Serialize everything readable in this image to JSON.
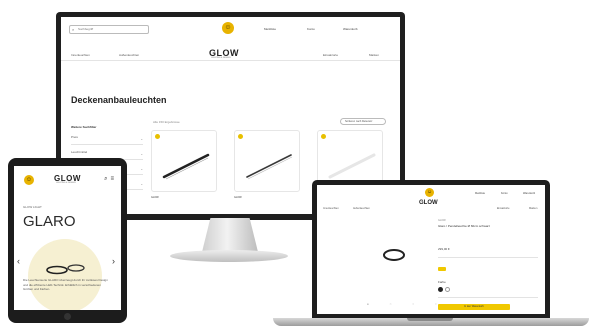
{
  "brand": {
    "name": "GLOW",
    "tagline": "LIGHTING & DESIGN",
    "logo_symbol": "☺",
    "accent_color": "#e8b300"
  },
  "monitor": {
    "search_placeholder": "Suchbegriff",
    "utility": {
      "wishlist": "Merkliste",
      "account": "Konto",
      "cart": "Warenkorb"
    },
    "nav_left": [
      "Innenleuchten",
      "Außenleuchten"
    ],
    "nav_right": [
      "Einsatzorte",
      "Marken"
    ],
    "page_title": "Deckenanbauleuchten",
    "filter_title": "Weitere Suchfilter",
    "filters": [
      "Preis",
      "Leuchtmittel",
      "Lichtfarbe",
      "Farbe"
    ],
    "result_count": "Alle 150 Ergebnisse",
    "sort_label": "Sortieren nach Relevanz",
    "products": [
      {
        "brand": "GLOW",
        "name": "Pendelleuchte"
      },
      {
        "brand": "GLOW",
        "name": "Deckenleuchte"
      },
      {
        "brand": "GLOW",
        "name": "Anbauleuchte"
      }
    ]
  },
  "tablet": {
    "breadcrumb": "GLOW LIGHT",
    "title": "GLARO",
    "description": "Die Leuchtenserie GLARO überzeugt durch ihr zeitloses Design und die effiziente LED-Technik. Erhältlich in verschiedenen Größen und Farben."
  },
  "laptop": {
    "utility": {
      "wishlist": "Merkliste",
      "account": "Konto",
      "cart": "Warenkorb"
    },
    "nav_left": [
      "Innenleuchten",
      "Außenleuchten"
    ],
    "nav_right": [
      "Einsatzorte",
      "Marken"
    ],
    "product_brand": "GLOW",
    "product_title": "Glaro / Pendelleuchte Ø 60cm schwarz",
    "price": "299,00 €",
    "color_label": "Farbe",
    "cart_button": "In den Warenkorb"
  }
}
